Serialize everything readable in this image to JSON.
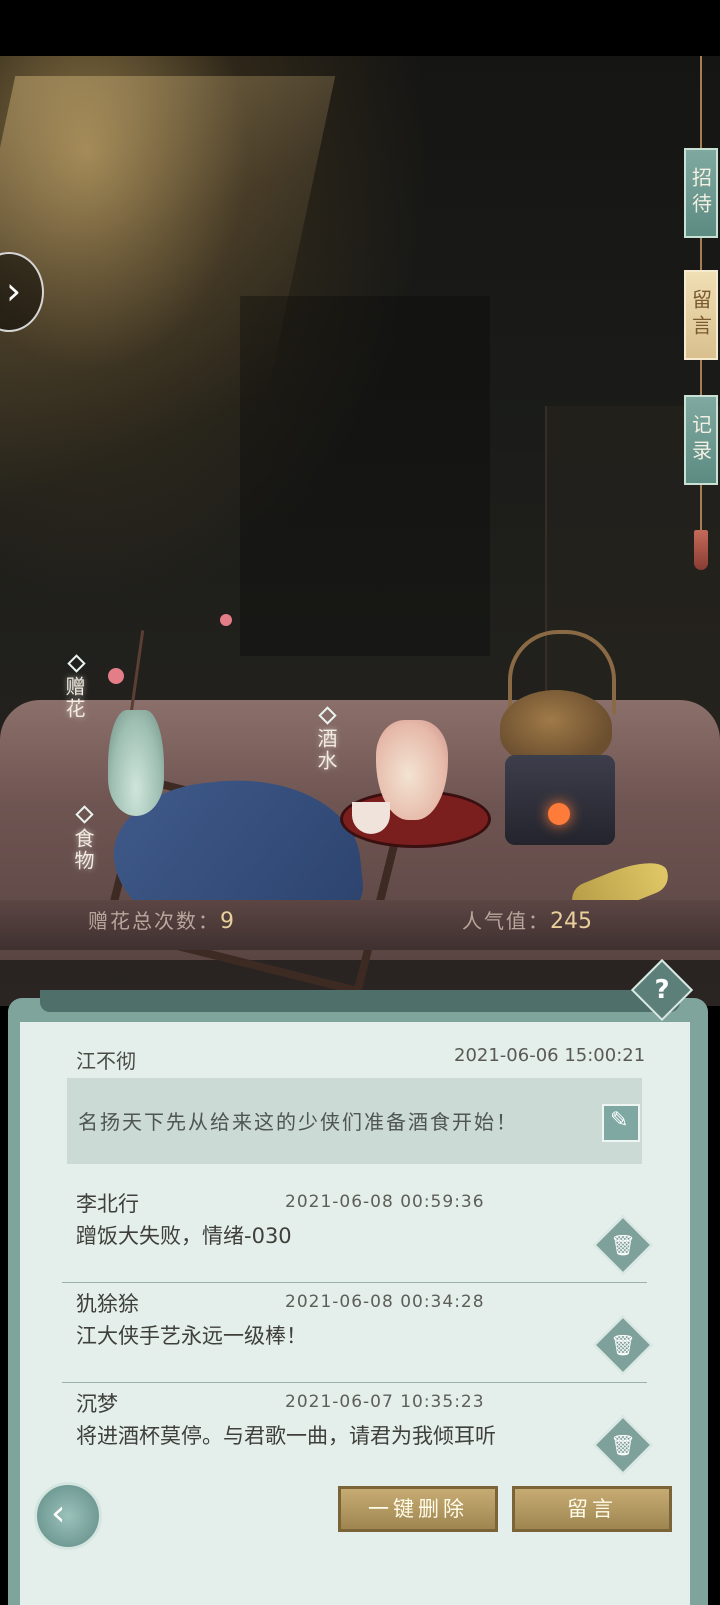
{
  "side_tabs": [
    {
      "label": "招待",
      "active": false
    },
    {
      "label": "留言",
      "active": true
    },
    {
      "label": "记录",
      "active": false
    }
  ],
  "hotspots": {
    "flower": "赠花",
    "wine": "酒水",
    "food": "食物"
  },
  "stats": {
    "flower_label": "赠花总次数：",
    "flower_value": "9",
    "popularity_label": "人气值：",
    "popularity_value": "245"
  },
  "help_icon": "?",
  "owner": {
    "name": "江不彻",
    "time": "2021-06-06  15:00:21",
    "message": "名扬天下先从给来这的少侠们准备酒食开始！"
  },
  "messages": [
    {
      "name": "李北行",
      "time": "2021-06-08    00:59:36",
      "text": "蹭饭大失败，情绪-030"
    },
    {
      "name": "犰狳狳",
      "time": "2021-06-08    00:34:28",
      "text": "江大侠手艺永远一级棒！"
    },
    {
      "name": "沉梦",
      "time": "2021-06-07    10:35:23",
      "text": "将进酒杯莫停。与君歌一曲，请君为我倾耳听"
    }
  ],
  "buttons": {
    "delete_all": "一键删除",
    "leave_message": "留言"
  },
  "icons": {
    "left_arrow": "chevron-right-icon",
    "chat": "chat-icon",
    "edit": "pencil-icon",
    "delete": "trash-icon",
    "back": "back-icon"
  }
}
